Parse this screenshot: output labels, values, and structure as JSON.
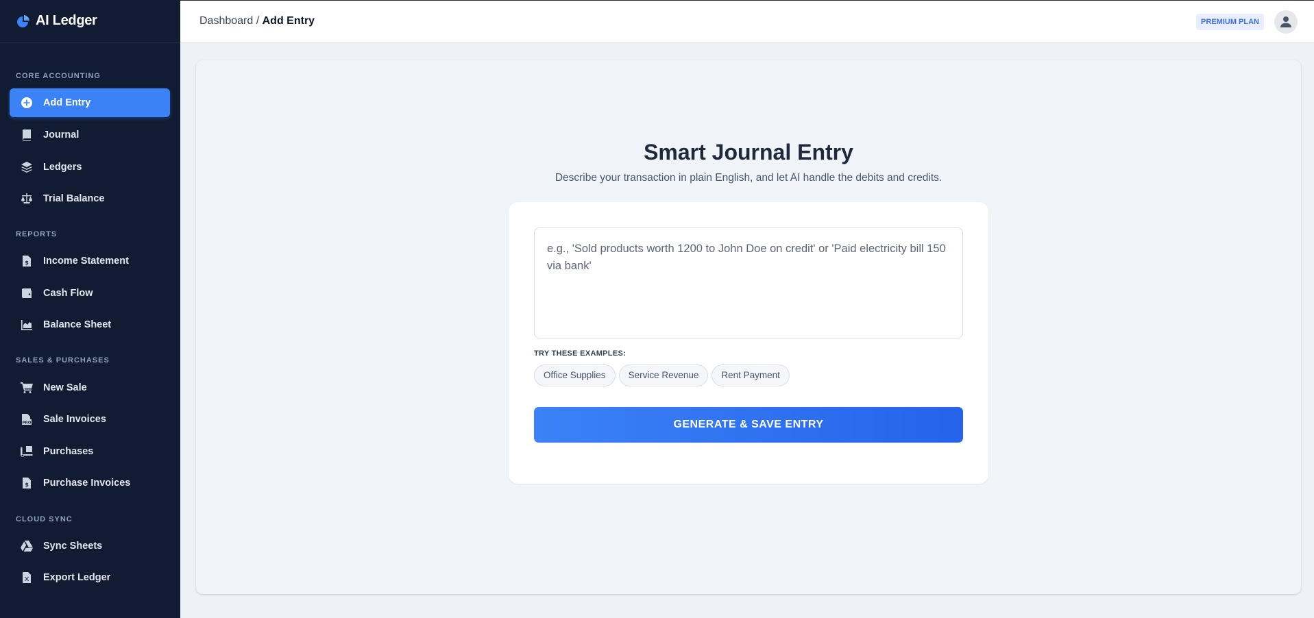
{
  "app": {
    "name": "AI Ledger"
  },
  "sidebar": {
    "sections": [
      {
        "label": "CORE ACCOUNTING"
      },
      {
        "label": "REPORTS"
      },
      {
        "label": "SALES & PURCHASES"
      },
      {
        "label": "CLOUD SYNC"
      }
    ],
    "items": [
      {
        "label": "Add Entry",
        "icon": "plus-circle-icon",
        "active": true
      },
      {
        "label": "Journal",
        "icon": "book-icon"
      },
      {
        "label": "Ledgers",
        "icon": "layers-icon"
      },
      {
        "label": "Trial Balance",
        "icon": "scale-icon"
      },
      {
        "label": "Income Statement",
        "icon": "file-dollar-icon"
      },
      {
        "label": "Cash Flow",
        "icon": "wallet-icon"
      },
      {
        "label": "Balance Sheet",
        "icon": "area-chart-icon"
      },
      {
        "label": "New Sale",
        "icon": "cart-icon"
      },
      {
        "label": "Sale Invoices",
        "icon": "file-invoice-icon"
      },
      {
        "label": "Purchases",
        "icon": "truck-loading-icon"
      },
      {
        "label": "Purchase Invoices",
        "icon": "file-dollar-icon"
      },
      {
        "label": "Sync Sheets",
        "icon": "google-drive-icon"
      },
      {
        "label": "Export Ledger",
        "icon": "file-excel-icon"
      }
    ]
  },
  "header": {
    "breadcrumb_root": "Dashboard",
    "breadcrumb_sep": " / ",
    "breadcrumb_current": "Add Entry",
    "badge": "PREMIUM PLAN"
  },
  "main": {
    "title": "Smart Journal Entry",
    "subtitle": "Describe your transaction in plain English, and let AI handle the debits and credits.",
    "input_placeholder": "e.g., 'Sold products worth 1200 to John Doe on credit' or 'Paid electricity bill 150 via bank'",
    "input_value": "",
    "examples_label": "TRY THESE EXAMPLES:",
    "examples": [
      "Office Supplies",
      "Service Revenue",
      "Rent Payment"
    ],
    "submit_label": "GENERATE & SAVE ENTRY"
  },
  "colors": {
    "sidebar_bg": "#111b31",
    "accent": "#3b82f6",
    "panel_bg": "#f0f4f9"
  }
}
